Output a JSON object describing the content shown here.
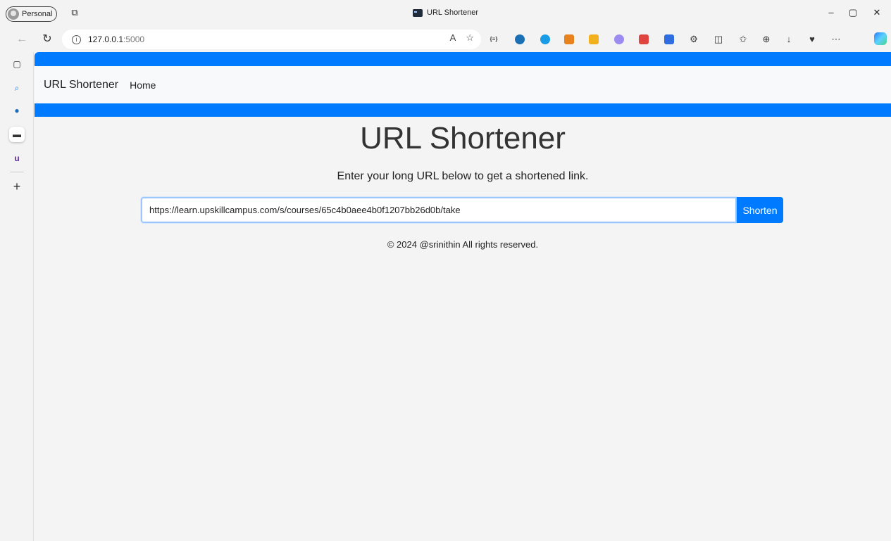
{
  "browser": {
    "profile_label": "Personal",
    "window_title": "URL Shortener",
    "address_host": "127.0.0.1",
    "address_port": ":5000",
    "ext_badge_text": "{≡}",
    "window_controls": {
      "minimize": "–",
      "restore": "▢",
      "close": "✕"
    }
  },
  "page": {
    "navbar": {
      "brand": "URL Shortener",
      "home_link": "Home"
    },
    "title": "URL Shortener",
    "subtitle": "Enter your long URL below to get a shortened link.",
    "form": {
      "url_value": "https://learn.upskillcampus.com/s/courses/65c4b0aee4b0f1207bb26d0b/take",
      "submit_label": "Shorten"
    },
    "footer": "© 2024 @srinithin All rights reserved."
  },
  "colors": {
    "primary": "#007bff",
    "navbar_bg": "#f8f9fa",
    "page_bg": "#f4f4f4"
  }
}
